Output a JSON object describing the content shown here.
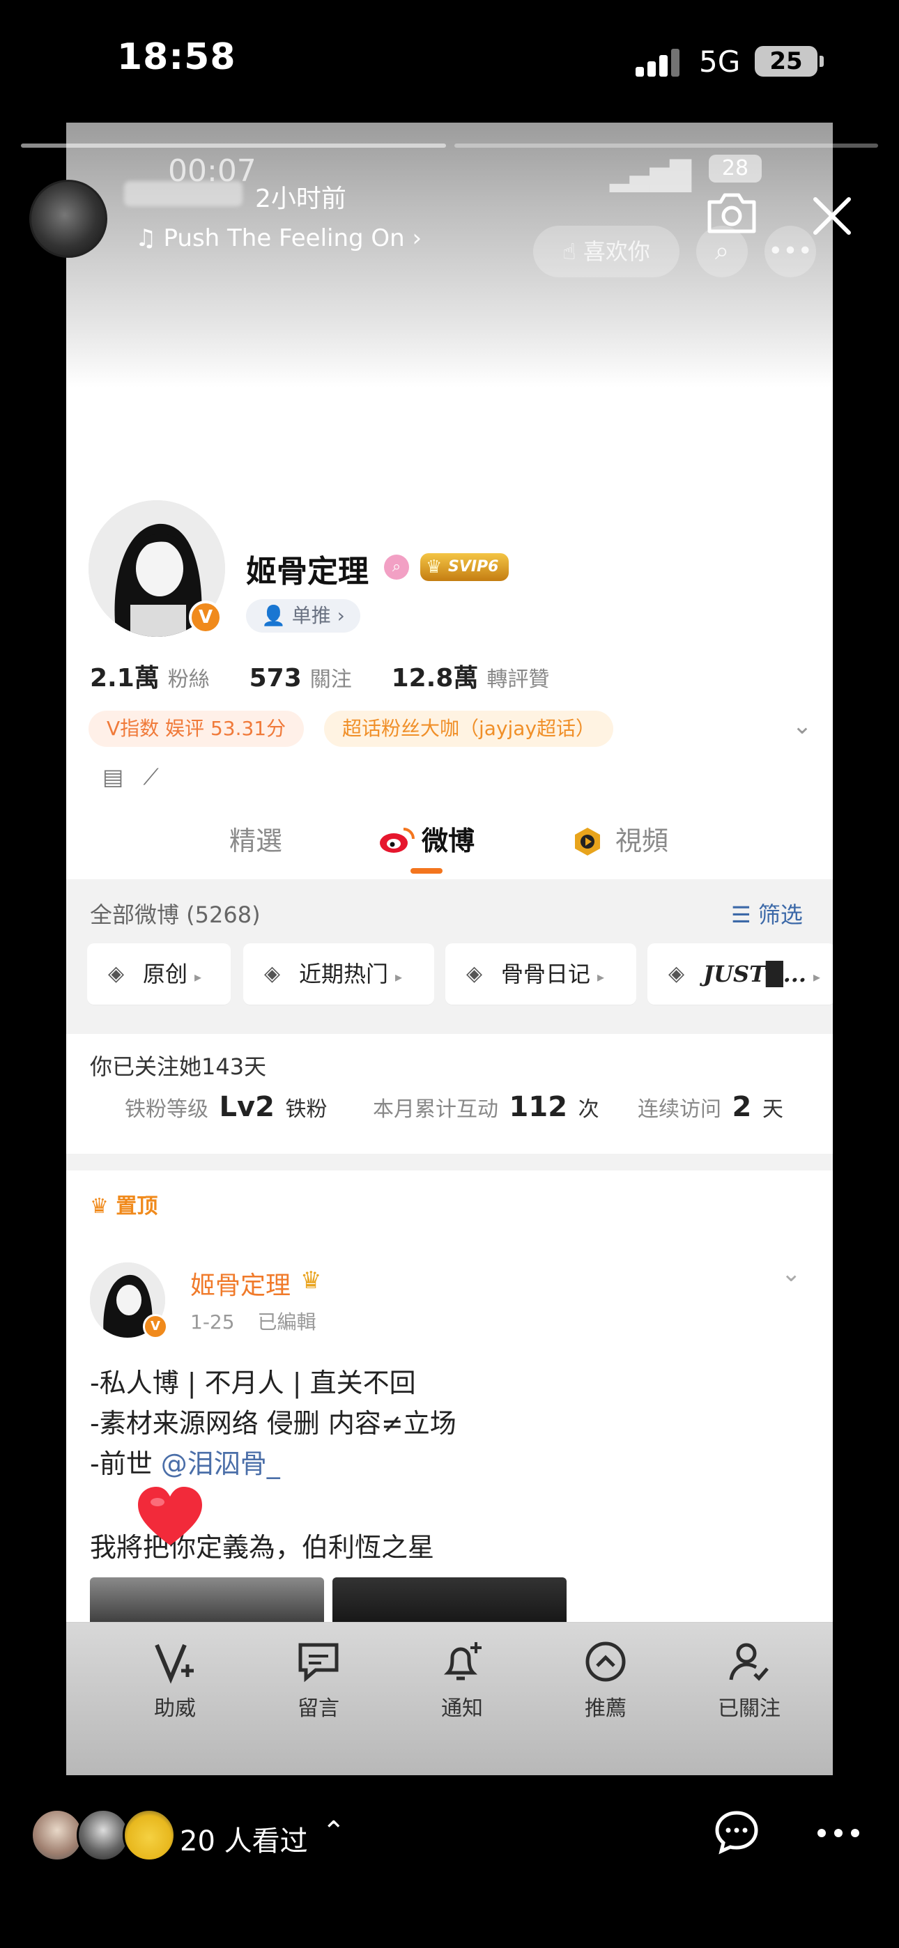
{
  "status_bar": {
    "time": "18:58",
    "network": "5G",
    "battery": "25"
  },
  "story": {
    "posted_ago": "2小时前",
    "music": "Push The Feeling On",
    "viewers_text": "20 人看过"
  },
  "inner_status": {
    "time": "00:07",
    "battery": "28"
  },
  "inner_header": {
    "like_label": "喜欢你"
  },
  "profile": {
    "name": "姬骨定理",
    "svip": "SVIP6",
    "chip": "单推",
    "stats": [
      {
        "value": "2.1萬",
        "label": "粉絲"
      },
      {
        "value": "573",
        "label": "關注"
      },
      {
        "value": "12.8萬",
        "label": "轉評贊"
      }
    ],
    "badge_v": "V指数 娱评 53.31分",
    "badge_super": "超话粉丝大咖（jayjay超话）"
  },
  "tabs": [
    {
      "label": "精選",
      "active": false
    },
    {
      "label": "微博",
      "active": true
    },
    {
      "label": "視頻",
      "active": false
    }
  ],
  "feed_header": {
    "all_label": "全部微博 (5268)",
    "filter_label": "筛选"
  },
  "categories": [
    "原创",
    "近期热门",
    "骨骨日记",
    "JUST█..."
  ],
  "fan_card": {
    "follow_days": "你已关注她143天",
    "level_label": "铁粉等级",
    "level_value": "Lv2",
    "level_unit": "铁粉",
    "interact_label": "本月累计互动",
    "interact_value": "112",
    "interact_unit": "次",
    "visit_label": "连续访问",
    "visit_value": "2",
    "visit_unit": "天"
  },
  "post": {
    "pinned_label": "置顶",
    "author": "姬骨定理",
    "date": "1-25",
    "edited": "已編輯",
    "lines": [
      "-私人博 | 不月人 | 直关不回",
      "-素材来源网络 侵删 内容≠立场"
    ],
    "line3_prefix": "-前世 ",
    "mention": "@泪泅骨_",
    "line4": "我將把你定義為，伯利恆之星"
  },
  "bottom_tabs": [
    {
      "label": "助威",
      "icon": "v-plus-icon"
    },
    {
      "label": "留言",
      "icon": "message-icon"
    },
    {
      "label": "通知",
      "icon": "bell-plus-icon"
    },
    {
      "label": "推薦",
      "icon": "up-circle-icon"
    },
    {
      "label": "已關注",
      "icon": "user-check-icon"
    }
  ],
  "colors": {
    "accent": "#f3751e",
    "link": "#3c69a8",
    "vip_orange": "#f08a1c"
  }
}
